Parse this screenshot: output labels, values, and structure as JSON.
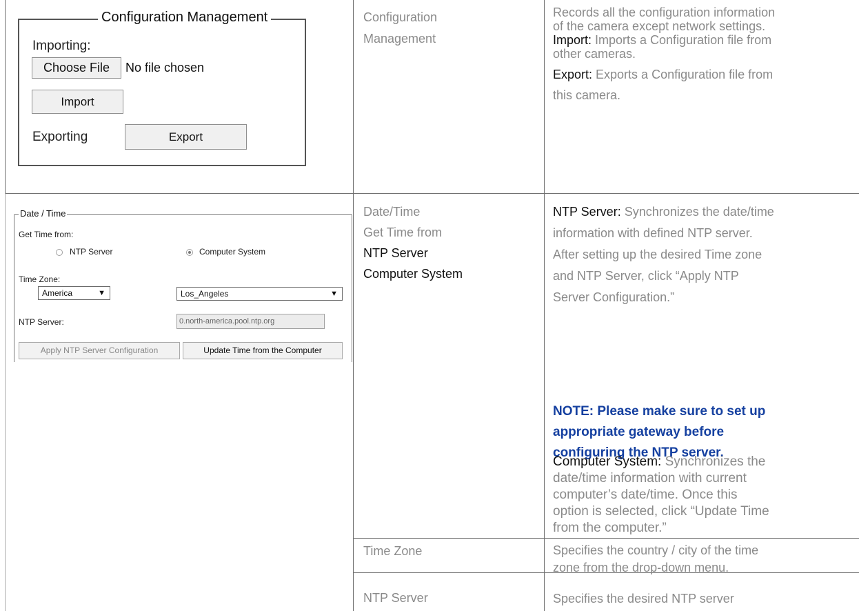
{
  "config_widget": {
    "title": "Configuration Management",
    "importing_label": "Importing:",
    "choose_file_label": "Choose File",
    "file_status": "No file chosen",
    "import_label": "Import",
    "exporting_label": "Exporting",
    "export_label": "Export"
  },
  "datetime_widget": {
    "title": "Date / Time",
    "get_time_from": "Get Time from:",
    "option_ntp": "NTP Server",
    "option_computer": "Computer System",
    "selected_option": "Computer System",
    "time_zone_label": "Time Zone:",
    "region_value": "America",
    "city_value": "Los_Angeles",
    "ntp_server_label": "NTP Server:",
    "ntp_server_value": "0.north-america.pool.ntp.org",
    "apply_label": "Apply NTP Server Configuration",
    "update_label": "Update Time from the Computer"
  },
  "table": {
    "row1": {
      "item_line1": "Configuration",
      "item_line2": "Management",
      "desc_line1": "Records all the configuration information",
      "desc_line2": "of the camera except network settings.",
      "import_term": "Import:",
      "import_text1": " Imports a Configuration file from",
      "import_text2": "other cameras.",
      "export_term": "Export:",
      "export_text1": " Exports a Configuration file from",
      "export_text2": "this camera."
    },
    "row2": {
      "item_date_time": "Date/Time",
      "item_get_time": "Get Time from",
      "item_ntp": "NTP Server",
      "item_computer": "Computer System",
      "ntp_term": "NTP Server:",
      "ntp_text1": " Synchronizes the date/time",
      "ntp_text2": "information with defined NTP server.",
      "ntp_text3": "After setting up the desired Time zone",
      "ntp_text4": "and NTP Server, click “Apply NTP",
      "ntp_text5": "Server Configuration.”",
      "note_line1": "NOTE: Please make sure to set up",
      "note_line2": "appropriate gateway before",
      "note_line3": "configuring the NTP server.",
      "computer_term": "Computer System:",
      "computer_text1": " Synchronizes the",
      "computer_text2": "date/time information with current",
      "computer_text3": "computer’s date/time. Once this",
      "computer_text4": "option is selected, click “Update Time",
      "computer_text5": "from the computer.”"
    },
    "row3": {
      "item": "Time Zone",
      "desc_line1": "Specifies the country / city of the time",
      "desc_line2": "zone from the drop-down menu."
    },
    "row4": {
      "item": "NTP Server",
      "desc_line1": "Specifies the desired NTP server"
    }
  },
  "colors": {
    "note_blue": "#1540a0",
    "grey_text": "#8a8a8a",
    "border": "#6e6e6e"
  }
}
